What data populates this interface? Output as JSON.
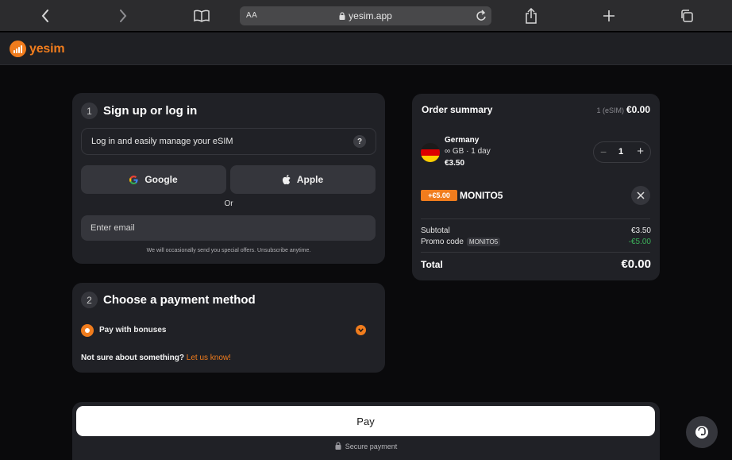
{
  "browser": {
    "text_size_label": "AA",
    "url": "yesim.app"
  },
  "brand": {
    "name": "yesim",
    "accent": "#f07c1d"
  },
  "signup": {
    "step": "1",
    "title": "Sign up or log in",
    "info": "Log in and easily manage your eSIM",
    "help_badge": "?",
    "google_label": "Google",
    "apple_label": "Apple",
    "or": "Or",
    "email_placeholder": "Enter email",
    "fine_print": "We will occasionally send you special offers. Unsubscribe anytime."
  },
  "payment": {
    "step": "2",
    "title": "Choose a payment method",
    "option": "Pay with bonuses",
    "help_text": "Not sure about something?",
    "help_link": "Let us know!"
  },
  "summary": {
    "title": "Order summary",
    "count": "1 (eSIM)",
    "total_top": "€0.00",
    "item": {
      "country": "Germany",
      "plan": "∞ GB · 1 day",
      "price": "€3.50",
      "quantity": "1",
      "minus": "−",
      "plus": "+"
    },
    "promo": {
      "tag": "+€5.00",
      "code": "MONITO5"
    },
    "subtotal_label": "Subtotal",
    "subtotal_value": "€3.50",
    "promo_label": "Promo code",
    "promo_chip": "MONITO5",
    "promo_value": "-€5.00",
    "total_label": "Total",
    "total_value": "€0.00"
  },
  "checkout": {
    "pay_label": "Pay",
    "secure_label": "Secure payment"
  }
}
